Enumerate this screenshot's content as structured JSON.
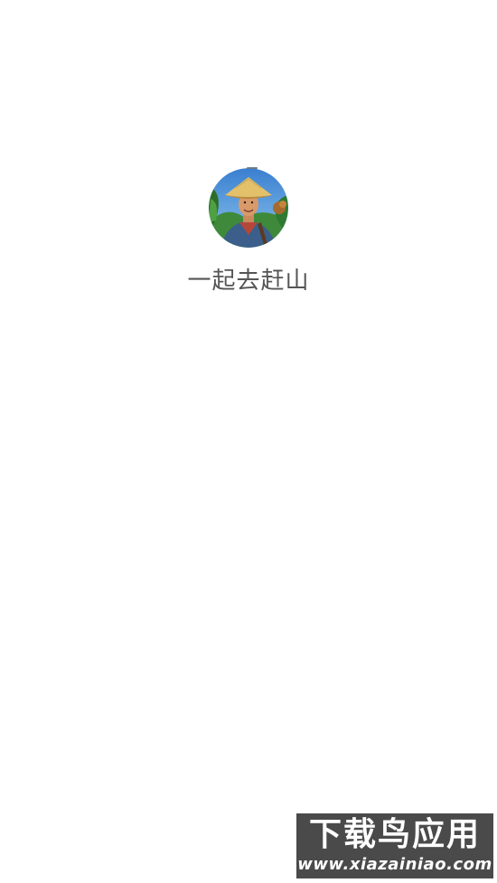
{
  "app": {
    "name": "一起去赶山",
    "icon": "farmer-avatar-icon"
  },
  "watermark": {
    "title": "下载鸟应用",
    "url": "www.xiazainiao.com"
  },
  "colors": {
    "background": "#ffffff",
    "app_name_text": "#555555",
    "watermark_bg": "#4a4a4a",
    "watermark_text": "#ffffff"
  }
}
